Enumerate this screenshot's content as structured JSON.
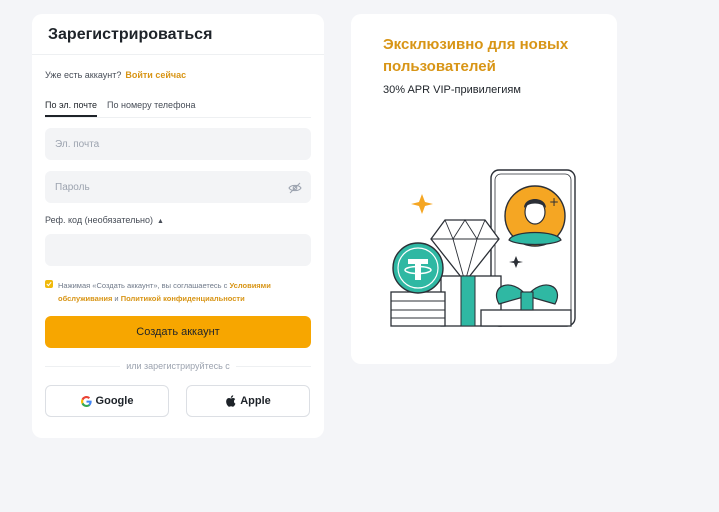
{
  "form": {
    "title": "Зарегистрироваться",
    "have_account_text": "Уже есть аккаунт?",
    "login_link": "Войти сейчас",
    "tabs": [
      {
        "label": "По эл. почте",
        "active": true
      },
      {
        "label": "По номеру телефона",
        "active": false
      }
    ],
    "email_placeholder": "Эл. почта",
    "password_placeholder": "Пароль",
    "ref_label": "Реф. код (необязательно)",
    "agree_prefix": "Нажимая «Создать аккаунт», вы соглашаетесь с ",
    "terms_link": "Условиями обслуживания",
    "agree_and": " и ",
    "privacy_link": "Политикой конфиденциальности",
    "agree_checked": true,
    "create_button": "Создать аккаунт",
    "or_text": "или зарегистрируйтесь с",
    "google_label": "Google",
    "apple_label": "Apple"
  },
  "promo": {
    "title": "Эксклюзивно для новых пользователей",
    "subtitle": "30% APR VIP-привилегиям"
  },
  "colors": {
    "accent": "#f7a600",
    "link": "#d89516",
    "teal": "#2fb8a3",
    "orange": "#f5a623"
  },
  "icons": [
    "eye-off-icon",
    "caret-up-icon",
    "checkbox-check-icon",
    "google-icon",
    "apple-icon"
  ]
}
